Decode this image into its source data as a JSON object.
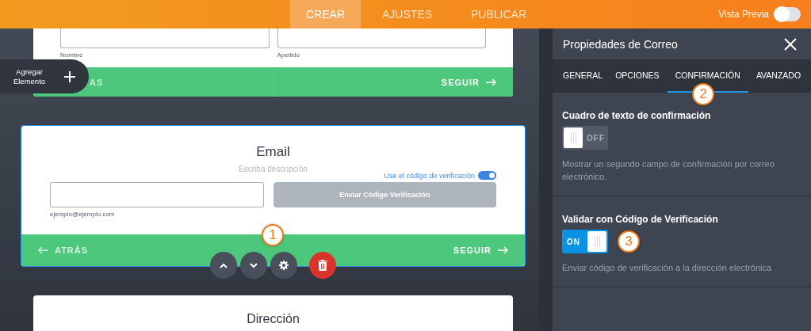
{
  "topbar": {
    "tabs": [
      {
        "label": "CREAR",
        "selected": true
      },
      {
        "label": "AJUSTES",
        "selected": false
      },
      {
        "label": "PUBLICAR",
        "selected": false
      }
    ],
    "preview": {
      "label": "Vista Previa",
      "on": false
    }
  },
  "add_element": {
    "label": "Agregar Elemento"
  },
  "name_card": {
    "fields": [
      {
        "label": "Nombre"
      },
      {
        "label": "Apellido"
      }
    ],
    "back": "AS",
    "next": "SEGUIR"
  },
  "email_card": {
    "title": "Email",
    "description": "Escriba descripción",
    "verify_toggle": {
      "label": "Use el código de verificación",
      "on": true
    },
    "sublabel": "ejemplo@ejemplo.com",
    "send_button": "Enviar Código Verificación",
    "back": "ATRÁS",
    "next": "SEGUIR",
    "annotation": "1"
  },
  "address_card": {
    "title": "Dirección"
  },
  "panel": {
    "title": "Propiedades de Correo",
    "tabs": [
      {
        "label": "GENERAL",
        "selected": false
      },
      {
        "label": "OPCIONES",
        "selected": false
      },
      {
        "label": "CONFIRMACIÓN",
        "selected": true
      },
      {
        "label": "AVANZADO",
        "selected": false
      }
    ],
    "tab_annotation": "2",
    "sections": [
      {
        "title": "Cuadro de texto de confirmación",
        "on": false,
        "toggle_text": "OFF",
        "description": "Mostrar un segundo campo de confirmación por correo electrónico."
      },
      {
        "title": "Validar con Código de Verificación",
        "on": true,
        "toggle_text": "ON",
        "description": "Enviar código de verificación a la dirección electrónica",
        "annotation": "3"
      }
    ]
  }
}
